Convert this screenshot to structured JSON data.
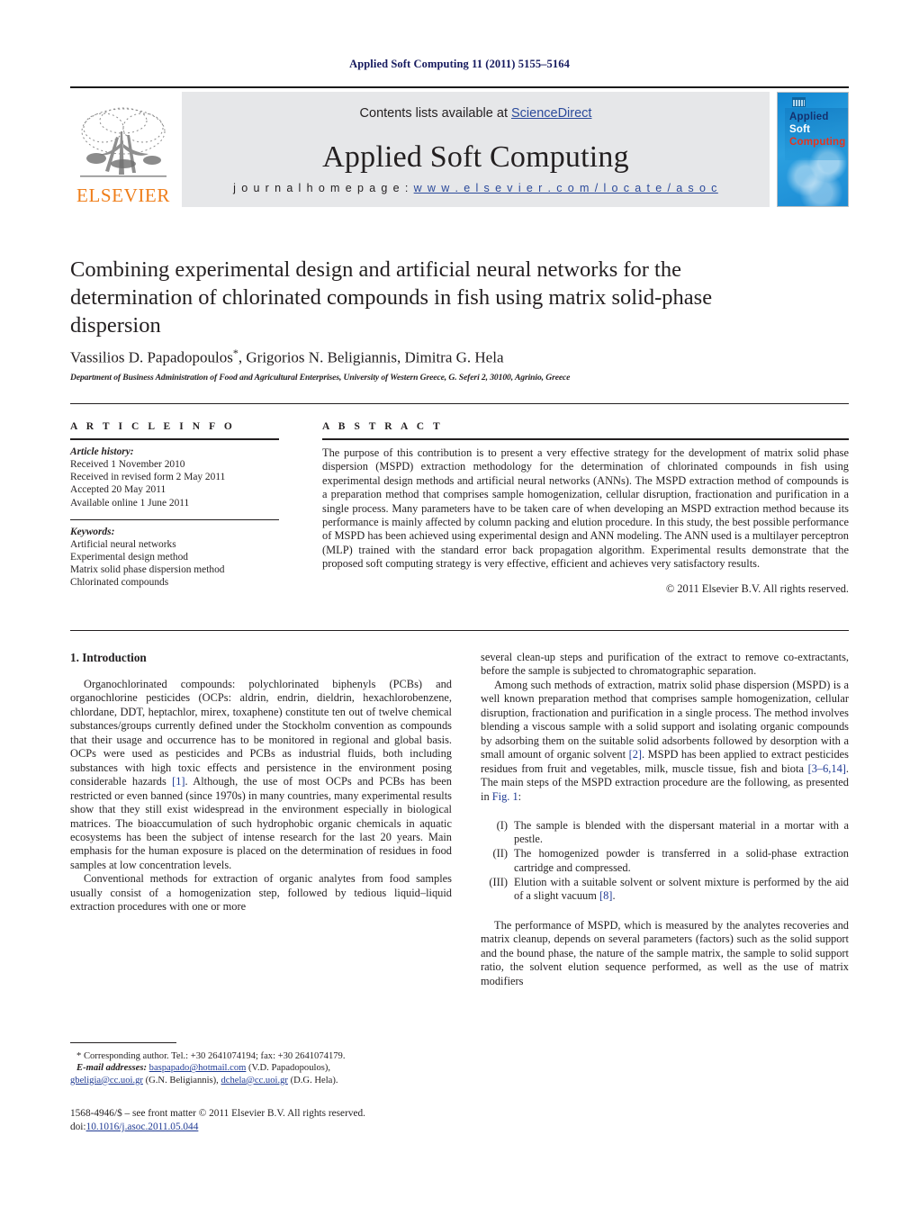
{
  "running_head": "Applied Soft Computing 11 (2011) 5155–5164",
  "masthead": {
    "publisher_logo_text": "ELSEVIER",
    "contents_prefix": "Contents lists available at ",
    "contents_link": "ScienceDirect",
    "journal_name": "Applied Soft Computing",
    "homepage_label": "j o u r n a l   h o m e p a g e :   ",
    "homepage_url": "w w w . e l s e v i e r . c o m / l o c a t e / a s o c",
    "cover": {
      "line1": "Applied",
      "line2": "Soft",
      "line3": "Computing",
      "color_bg": "#1f8fd6",
      "color_line1": "#14306e",
      "color_line2": "#ffffff",
      "color_line3": "#e8341c"
    },
    "colors": {
      "elsevier_orange": "#ef7d18",
      "link_blue": "#2b4a9b",
      "band_gray": "#e6e7e9"
    }
  },
  "article": {
    "title": "Combining experimental design and artificial neural networks for the determination of chlorinated compounds in fish using matrix solid-phase dispersion",
    "authors": "Vassilios D. Papadopoulos*, Grigorios N. Beligiannis, Dimitra G. Hela",
    "affiliation": "Department of Business Administration of Food and Agricultural Enterprises, University of Western Greece, G. Seferi 2, 30100, Agrinio, Greece"
  },
  "article_info": {
    "heading": "A R T I C L E   I N F O",
    "history_label": "Article history:",
    "history": [
      "Received 1 November 2010",
      "Received in revised form 2 May 2011",
      "Accepted 20 May 2011",
      "Available online 1 June 2011"
    ],
    "keywords_label": "Keywords:",
    "keywords": [
      "Artificial neural networks",
      "Experimental design method",
      "Matrix solid phase dispersion method",
      "Chlorinated compounds"
    ]
  },
  "abstract": {
    "heading": "A B S T R A C T",
    "text": "The purpose of this contribution is to present a very effective strategy for the development of matrix solid phase dispersion (MSPD) extraction methodology for the determination of chlorinated compounds in fish using experimental design methods and artificial neural networks (ANNs). The MSPD extraction method of compounds is a preparation method that comprises sample homogenization, cellular disruption, fractionation and purification in a single process. Many parameters have to be taken care of when developing an MSPD extraction method because its performance is mainly affected by column packing and elution procedure. In this study, the best possible performance of MSPD has been achieved using experimental design and ANN modeling. The ANN used is a multilayer perceptron (MLP) trained with the standard error back propagation algorithm. Experimental results demonstrate that the proposed soft computing strategy is very effective, efficient and achieves very satisfactory results.",
    "copyright": "© 2011 Elsevier B.V. All rights reserved."
  },
  "sections": {
    "intro_heading": "1.  Introduction",
    "left_paragraphs": [
      "Organochlorinated compounds: polychlorinated biphenyls (PCBs) and organochlorine pesticides (OCPs: aldrin, endrin, dieldrin, hexachlorobenzene, chlordane, DDT, heptachlor, mirex, toxaphene) constitute ten out of twelve chemical substances/groups currently defined under the Stockholm convention as compounds that their usage and occurrence has to be monitored in regional and global basis. OCPs were used as pesticides and PCBs as industrial fluids, both including substances with high toxic effects and persistence in the environment posing considerable hazards [1]. Although, the use of most OCPs and PCBs has been restricted or even banned (since 1970s) in many countries, many experimental results show that they still exist widespread in the environment especially in biological matrices. The bioaccumulation of such hydrophobic organic chemicals in aquatic ecosystems has been the subject of intense research for the last 20 years. Main emphasis for the human exposure is placed on the determination of residues in food samples at low concentration levels.",
      "Conventional methods for extraction of organic analytes from food samples usually consist of a homogenization step, followed by tedious liquid–liquid extraction procedures with one or more"
    ],
    "right_paragraphs": [
      "several clean-up steps and purification of the extract to remove co-extractants, before the sample is subjected to chromatographic separation.",
      "Among such methods of extraction, matrix solid phase dispersion (MSPD) is a well known preparation method that comprises sample homogenization, cellular disruption, fractionation and purification in a single process. The method involves blending a viscous sample with a solid support and isolating organic compounds by adsorbing them on the suitable solid adsorbents followed by desorption with a small amount of organic solvent [2]. MSPD has been applied to extract pesticides residues from fruit and vegetables, milk, muscle tissue, fish and biota [3–6,14]. The main steps of the MSPD extraction procedure are the following, as presented in Fig. 1:",
      "The performance of MSPD, which is measured by the analytes recoveries and matrix cleanup, depends on several parameters (factors) such as the solid support and the bound phase, the nature of the sample matrix, the sample to solid support ratio, the solvent elution sequence performed, as well as the use of matrix modifiers"
    ],
    "steps": [
      {
        "num": "(I)",
        "text": "The sample is blended with the dispersant material in a mortar with a pestle."
      },
      {
        "num": "(II)",
        "text": "The homogenized powder is transferred in a solid-phase extraction cartridge and compressed."
      },
      {
        "num": "(III)",
        "text": "Elution with a suitable solvent or solvent mixture is performed by the aid of a slight vacuum [8]."
      }
    ]
  },
  "footnote": {
    "corresponding": "* Corresponding author. Tel.: +30 2641074194; fax: +30 2641074179.",
    "email_label": "E-mail addresses:",
    "emails": [
      {
        "address": "baspapado@hotmail.com",
        "owner": "(V.D. Papadopoulos),"
      },
      {
        "address": "gbeligia@cc.uoi.gr",
        "owner": "(G.N. Beligiannis),"
      },
      {
        "address": "dchela@cc.uoi.gr",
        "owner": "(D.G. Hela)."
      }
    ]
  },
  "imprint": {
    "issn_line": "1568-4946/$ – see front matter © 2011 Elsevier B.V. All rights reserved.",
    "doi_label": "doi:",
    "doi_value": "10.1016/j.asoc.2011.05.044"
  }
}
